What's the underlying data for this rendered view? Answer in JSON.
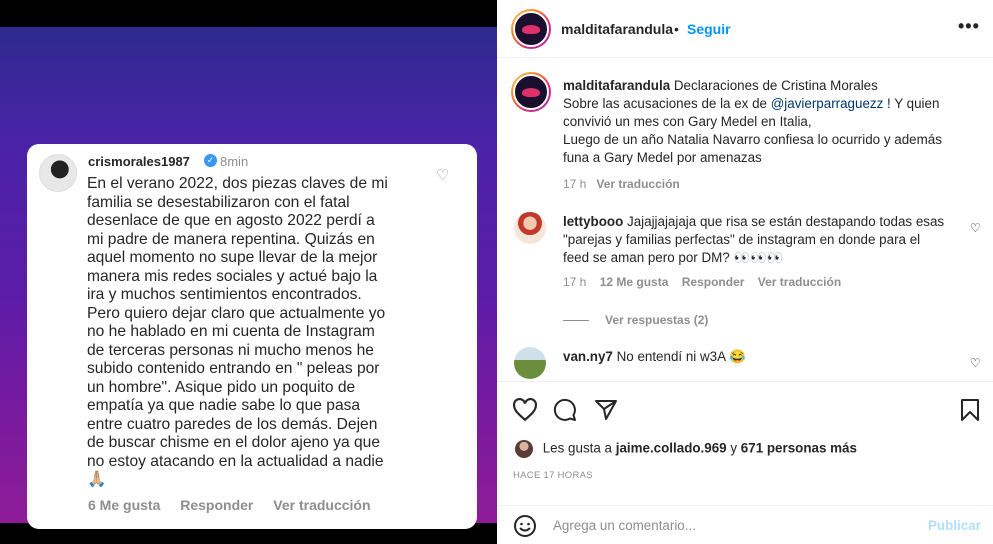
{
  "media": {
    "story": {
      "username": "crismorales1987",
      "time": "8min",
      "lines": [
        "En el verano 2022, dos piezas claves de mi",
        "familia se desestabilizaron con el fatal",
        "desenlace de que en agosto 2022 perdí a",
        "mi padre de manera repentina. Quizás en",
        "aquel momento no supe llevar de la mejor",
        "manera mis redes sociales y actué bajo la",
        "ira y muchos sentimientos encontrados.",
        "Pero quiero dejar claro que actualmente yo",
        "no he hablado en mi cuenta de Instagram",
        "de terceras personas ni mucho menos he",
        "subido contenido entrando en \" peleas por",
        "un hombre\". Asique pido un poquito de",
        "empatía ya que nadie sabe lo que pasa",
        "entre cuatro paredes de los demás. Dejen",
        "de buscar chisme en el dolor ajeno ya que",
        "no estoy atacando en la actualidad a nadie",
        "🙏🏼"
      ],
      "likes": "6 Me gusta",
      "reply": "Responder",
      "translate": "Ver traducción"
    }
  },
  "header": {
    "username": "malditafarandula",
    "dot": "•",
    "follow": "Seguir",
    "more": "•••"
  },
  "caption": {
    "username": "malditafarandula",
    "line1": "Declaraciones de Cristina Morales",
    "line2_pre": "Sobre las acusaciones de la ex de",
    "mention": "@javierparraguezz",
    "line2_post": "! Y quien",
    "line3": "convivió un mes con Gary Medel en Italia,",
    "line4": "Luego de un año Natalia Navarro confiesa lo ocurrido y además",
    "line5": "funa a Gary Medel por amenazas",
    "time": "17 h",
    "translate": "Ver traducción"
  },
  "comments": [
    {
      "username": "lettybooo",
      "line1": "Jajajjajajaja que risa se están destapando todas esas",
      "line2": "\"parejas y familias perfectas\" de instagram en donde para el",
      "line3": "feed se aman pero por DM? 👀👀👀",
      "time": "17 h",
      "likes": "12 Me gusta",
      "reply": "Responder",
      "translate": "Ver traducción",
      "view_replies": "Ver respuestas (2)"
    },
    {
      "username": "van.ny7",
      "text": "No entendí ni w3A 😂"
    }
  ],
  "likes": {
    "prefix": "Les gusta a",
    "user": "jaime.collado.969",
    "conj": "y",
    "others": "671 personas más"
  },
  "posted": "HACE 17 HORAS",
  "add_comment": {
    "placeholder": "Agrega un comentario...",
    "publish": "Publicar"
  },
  "colors": {
    "accent": "#0095f6",
    "publish_disabled": "#b2dffc",
    "muted": "#8e8e8e",
    "media_gradient_top": "#2d2a8f",
    "media_gradient_bottom": "#8e1c98"
  }
}
